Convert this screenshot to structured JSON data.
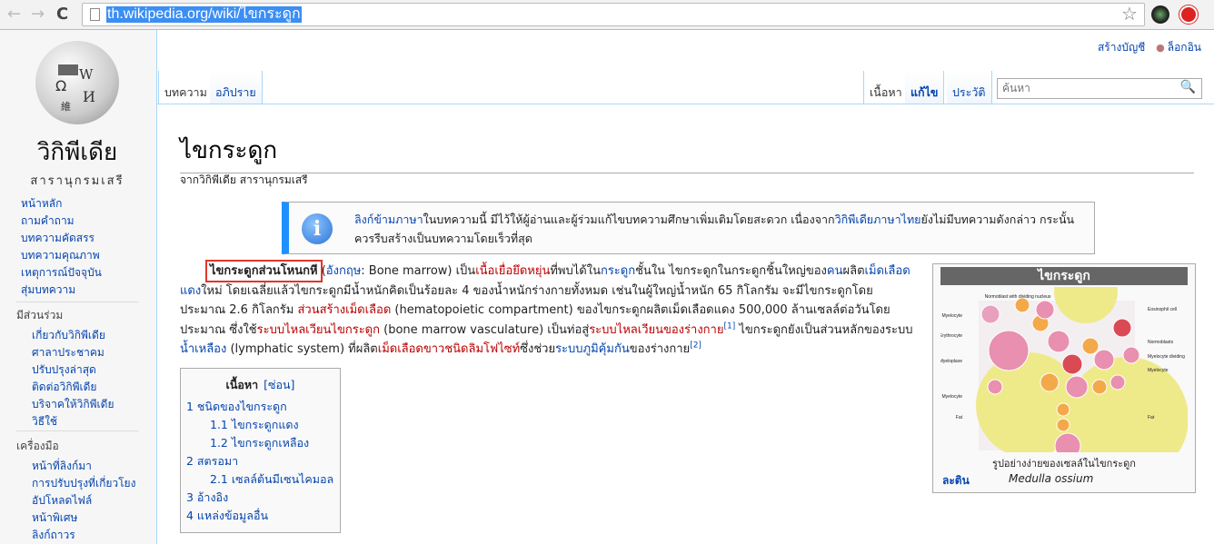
{
  "browser": {
    "url": "th.wikipedia.org/wiki/ไขกระดูก",
    "back": "←",
    "forward": "→",
    "reload": "C",
    "star": "☆"
  },
  "logo": {
    "wordmark": "วิกิพีเดีย",
    "tagline": "สารานุกรมเสรี",
    "globe_glyphs": [
      "Ω",
      "W",
      "И",
      "維"
    ]
  },
  "sidebar": {
    "nav": [
      "หน้าหลัก",
      "ถามคำถาม",
      "บทความคัดสรร",
      "บทความคุณภาพ",
      "เหตุการณ์ปัจจุบัน",
      "สุ่มบทความ"
    ],
    "interaction": {
      "heading": "มีส่วนร่วม",
      "items": [
        "เกี่ยวกับวิกิพีเดีย",
        "ศาลาประชาคม",
        "ปรับปรุงล่าสุด",
        "ติดต่อวิกิพีเดีย",
        "บริจาคให้วิกิพีเดีย",
        "วิธีใช้"
      ]
    },
    "tools": {
      "heading": "เครื่องมือ",
      "items": [
        "หน้าที่ลิงก์มา",
        "การปรับปรุงที่เกี่ยวโยง",
        "อัปโหลดไฟล์",
        "หน้าพิเศษ",
        "ลิงก์ถาวร"
      ]
    }
  },
  "personal": {
    "create_account": "สร้างบัญชี",
    "login": "ล็อกอิน"
  },
  "tabs": {
    "article": "บทความ",
    "talk": "อภิปราย",
    "read": "เนื้อหา",
    "edit": "แก้ไข",
    "history": "ประวัติ"
  },
  "search": {
    "placeholder": "ค้นหา"
  },
  "article": {
    "title": "ไขกระดูก",
    "subtitle": "จากวิกิพีเดีย สารานุกรมเสรี",
    "notice": [
      {
        "t": "link",
        "v": "ลิงก์ข้ามภาษา"
      },
      {
        "t": "text",
        "v": "ในบทความนี้ มีไว้ให้ผู้อ่านและผู้ร่วมแก้ไขบทความศึกษาเพิ่มเติมโดยสะดวก เนื่องจาก"
      },
      {
        "t": "link",
        "v": "วิกิพีเดียภาษาไทย"
      },
      {
        "t": "text",
        "v": "ยังไม่มีบทความดังกล่าว กระนั้น ควรรีบสร้างเป็นบทความโดยเร็วที่สุด"
      }
    ],
    "paragraph": [
      {
        "t": "bold",
        "v": "ไขกระดูกส่วนโหนกหี"
      },
      {
        "t": "text",
        "v": " ("
      },
      {
        "t": "link",
        "v": "อังกฤษ"
      },
      {
        "t": "text",
        "v": ": Bone marrow) เป็น"
      },
      {
        "t": "redlink",
        "v": "เนื้อเยื่อยึดหยุ่น"
      },
      {
        "t": "text",
        "v": "ที่พบได้ใน"
      },
      {
        "t": "link",
        "v": "กระดูก"
      },
      {
        "t": "text",
        "v": "ชั้นใน ไขกระดูกในกระดูกชิ้นใหญ่ของ"
      },
      {
        "t": "link",
        "v": "คน"
      },
      {
        "t": "text",
        "v": "ผลิต"
      },
      {
        "t": "link",
        "v": "เม็ดเลือดแดง"
      },
      {
        "t": "text",
        "v": "ใหม่ โดยเฉลี่ยแล้วไขกระดูกมีน้ำหนักคิดเป็นร้อยละ 4 ของน้ำหนักร่างกายทั้งหมด เช่นในผู้ใหญ่น้ำหนัก 65 กิโลกรัม จะมีไขกระดูกโดยประมาณ 2.6 กิโลกรัม "
      },
      {
        "t": "redlink",
        "v": "ส่วนสร้างเม็ดเลือด"
      },
      {
        "t": "text",
        "v": " (hematopoietic compartment) ของไขกระดูกผลิตเม็ดเลือดแดง 500,000 ล้านเซลล์ต่อวันโดยประมาณ ซึ่งใช้"
      },
      {
        "t": "redlink",
        "v": "ระบบไหลเวียนไขกระดูก"
      },
      {
        "t": "text",
        "v": " (bone marrow vasculature) เป็นท่อสู่"
      },
      {
        "t": "redlink",
        "v": "ระบบไหลเวียนของร่างกาย"
      },
      {
        "t": "sup",
        "v": "[1]"
      },
      {
        "t": "text",
        "v": " ไขกระดูกยังเป็นส่วนหลักของระบบ"
      },
      {
        "t": "link",
        "v": "น้ำเหลือง"
      },
      {
        "t": "text",
        "v": " (lymphatic system) ที่ผลิต"
      },
      {
        "t": "redlink",
        "v": "เม็ดเลือดขาวชนิดลิมโฟไซท์"
      },
      {
        "t": "text",
        "v": "ซึ่งช่วย"
      },
      {
        "t": "link",
        "v": "ระบบภูมิคุ้มกัน"
      },
      {
        "t": "text",
        "v": "ของร่างกาย"
      },
      {
        "t": "sup",
        "v": "[2]"
      }
    ]
  },
  "toc": {
    "title": "เนื้อหา",
    "toggle": "[ซ่อน]",
    "items": [
      {
        "level": 1,
        "label": "1 ชนิดของไขกระดูก"
      },
      {
        "level": 2,
        "label": "1.1 ไขกระดูกแดง"
      },
      {
        "level": 2,
        "label": "1.2 ไขกระดูกเหลือง"
      },
      {
        "level": 1,
        "label": "2 สตรอมา"
      },
      {
        "level": 2,
        "label": "2.1 เซลล์ต้นมีเซนไคมอล"
      },
      {
        "level": 1,
        "label": "3 อ้างอิง"
      },
      {
        "level": 1,
        "label": "4 แหล่งข้อมูลอื่น"
      }
    ]
  },
  "infobox": {
    "title": "ไขกระดูก",
    "caption": "รูปอย่างง่ายของเซลล์ในไขกระดูก",
    "latin_label": "ละติน",
    "latin_value": "Medulla ossium",
    "diagram_labels": [
      "Normoblast with dividing nucleus",
      "Myelocyte",
      "Erythrocyte",
      "Myeloplaxe",
      "Myelocyte",
      "Fat",
      "Eosinophil cell",
      "Normoblasts",
      "Myelocyte dividing",
      "Myelocyte",
      "Fat"
    ]
  },
  "colors": {
    "link": "#0645ad",
    "redlink": "#ba0000",
    "highlight_box": "#e0352b",
    "notice_bar": "#1e90ff",
    "url_selection": "#3b8ef3"
  }
}
